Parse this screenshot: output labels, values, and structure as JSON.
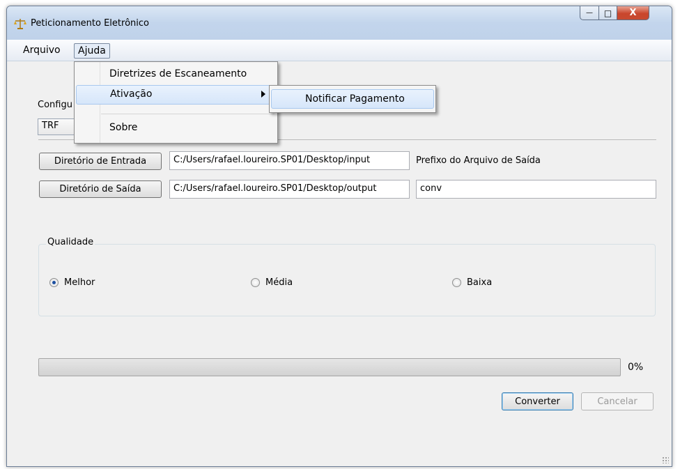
{
  "window": {
    "title": "Peticionamento Eletrônico"
  },
  "controls": {
    "minimize": "—",
    "maximize": "□",
    "close": "X"
  },
  "menubar": {
    "items": [
      "Arquivo",
      "Ajuda"
    ]
  },
  "help_menu": {
    "items": [
      {
        "label": "Diretrizes de Escaneamento"
      },
      {
        "label": "Ativação"
      },
      {
        "label": "Sobre"
      }
    ],
    "submenu": {
      "label": "Notificar Pagamento"
    }
  },
  "config": {
    "label": "Configu",
    "value": "TRF"
  },
  "dirs": {
    "input_button": "Diretório de Entrada",
    "input_path": "C:/Users/rafael.loureiro.SP01/Desktop/input",
    "output_button": "Diretório de Saída",
    "output_path": "C:/Users/rafael.loureiro.SP01/Desktop/output",
    "prefix_label": "Prefixo do Arquivo de Saída",
    "prefix_value": "conv"
  },
  "quality": {
    "title": "Qualidade",
    "options": [
      {
        "label": "Melhor",
        "checked": true
      },
      {
        "label": "Média",
        "checked": false
      },
      {
        "label": "Baixa",
        "checked": false
      }
    ]
  },
  "progress": {
    "percent": 0,
    "text": "0%"
  },
  "actions": {
    "convert": "Converter",
    "cancel": "Cancelar"
  }
}
